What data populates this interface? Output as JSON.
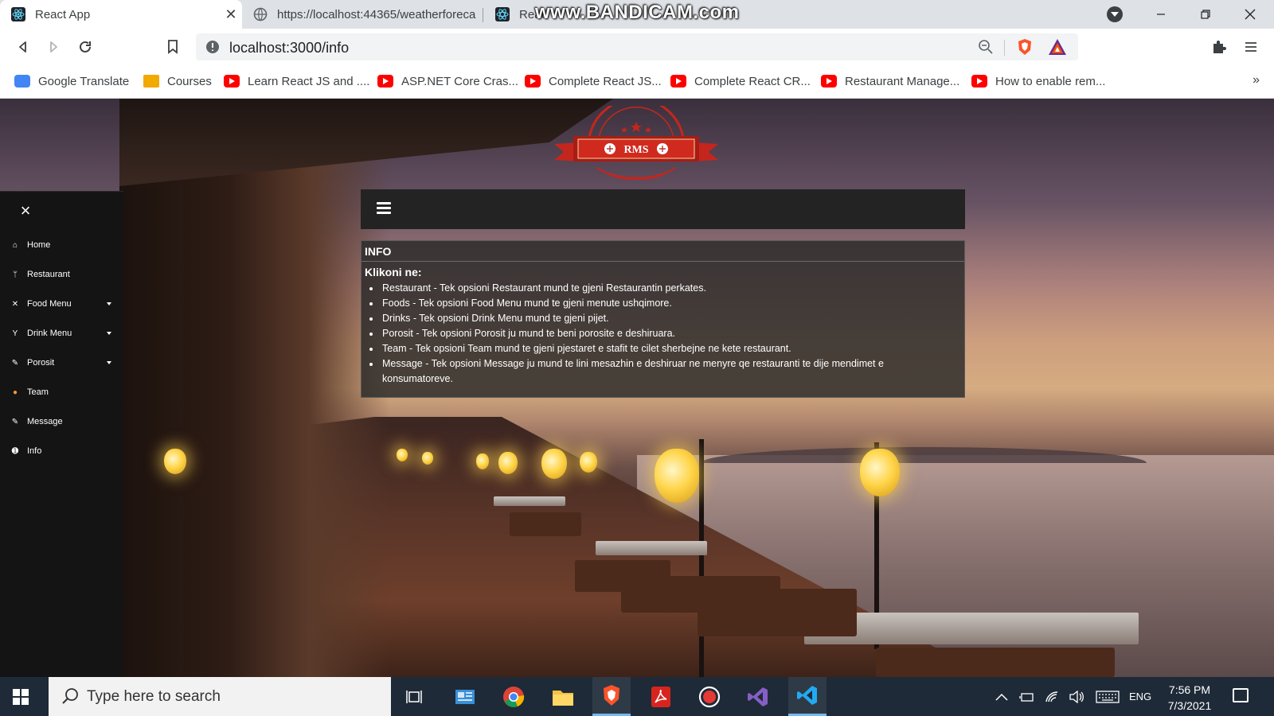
{
  "browser": {
    "tabs": [
      {
        "title": "React App",
        "active": true
      },
      {
        "title": "https://localhost:44365/weatherforeca",
        "active": false
      },
      {
        "title": "Reac",
        "active": false
      }
    ],
    "watermark": "www.BANDICAM.com",
    "address": "localhost:3000/info",
    "bookmarks": [
      {
        "label": "Google Translate",
        "icon": "google-translate-icon"
      },
      {
        "label": "Courses",
        "icon": "courses-icon"
      },
      {
        "label": "Learn React JS and ....",
        "icon": "youtube-icon"
      },
      {
        "label": "ASP.NET Core Cras...",
        "icon": "youtube-icon"
      },
      {
        "label": "Complete React JS...",
        "icon": "youtube-icon"
      },
      {
        "label": "Complete React CR...",
        "icon": "youtube-icon"
      },
      {
        "label": "Restaurant Manage...",
        "icon": "youtube-icon"
      },
      {
        "label": "How to enable rem...",
        "icon": "youtube-icon"
      }
    ],
    "more_bookmarks": "»"
  },
  "app": {
    "logo_text": "RMS",
    "sidebar": {
      "close": "×",
      "items": [
        {
          "label": "Home",
          "icon": "home-icon",
          "dropdown": false
        },
        {
          "label": "Restaurant",
          "icon": "cutlery-icon",
          "dropdown": false
        },
        {
          "label": "Food Menu",
          "icon": "food-icon",
          "dropdown": true
        },
        {
          "label": "Drink Menu",
          "icon": "cocktail-icon",
          "dropdown": true
        },
        {
          "label": "Porosit",
          "icon": "pen-icon",
          "dropdown": true
        },
        {
          "label": "Team",
          "icon": "team-icon",
          "dropdown": false
        },
        {
          "label": "Message",
          "icon": "pen-icon",
          "dropdown": false
        },
        {
          "label": "Info",
          "icon": "info-icon",
          "dropdown": false
        }
      ]
    },
    "info": {
      "heading": "INFO",
      "subheading": "Klikoni ne:",
      "items": [
        "Restaurant - Tek opsioni Restaurant mund te gjeni Restaurantin perkates.",
        "Foods - Tek opsioni Food Menu mund te gjeni menute ushqimore.",
        "Drinks - Tek opsioni Drink Menu mund te gjeni pijet.",
        "Porosit - Tek opsioni Porosit ju mund te beni porosite e deshiruara.",
        "Team - Tek opsioni Team mund te gjeni pjestaret e stafit te cilet sherbejne ne kete restaurant.",
        "Message - Tek opsioni Message ju mund te lini mesazhin e deshiruar ne menyre qe restauranti te dije mendimet e konsumatoreve."
      ]
    }
  },
  "taskbar": {
    "search_placeholder": "Type here to search",
    "language": "ENG",
    "time": "7:56 PM",
    "date": "7/3/2021"
  },
  "colors": {
    "sidebar_bg": "#141414",
    "navbar_bg": "#232323",
    "logo_red": "#c4261d",
    "taskbar_bg": "#1e2a38"
  }
}
